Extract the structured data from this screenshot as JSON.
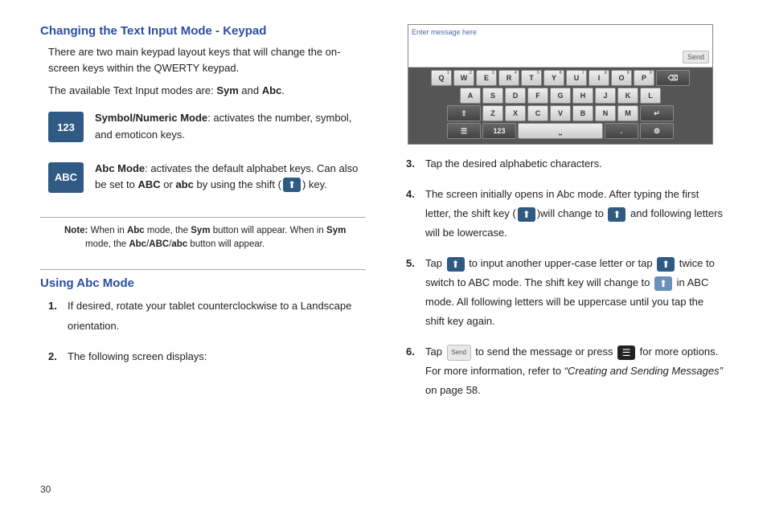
{
  "page_number": "30",
  "left": {
    "h1": "Changing the Text Input Mode - Keypad",
    "p1": "There are two main keypad layout keys that will change the on-screen keys within the QWERTY keypad.",
    "p2_pre": "The available Text Input modes are: ",
    "p2_sym": "Sym",
    "p2_mid": " and ",
    "p2_abc": "Abc",
    "p2_end": ".",
    "tile123": "123",
    "mode123_b": "Symbol/Numeric Mode",
    "mode123_t": ": activates the number, symbol, and emoticon keys.",
    "tileABC": "ABC",
    "modeABC_b": "Abc Mode",
    "modeABC_t1": ": activates the default alphabet keys. Can also be set to ",
    "modeABC_b2": "ABC",
    "modeABC_mid": " or ",
    "modeABC_b3": "abc",
    "modeABC_t2": " by using the shift (",
    "modeABC_t3": ") key.",
    "note_lbl": "Note:",
    "note_1": " When in ",
    "note_b1": "Abc",
    "note_2": " mode, the ",
    "note_b2": "Sym",
    "note_3": " button will appear. When in ",
    "note_b3": "Sym",
    "note_4": " mode, the ",
    "note_b4": "Abc",
    "note_slash1": "/",
    "note_b5": "ABC",
    "note_slash2": "/",
    "note_b6": "abc",
    "note_5": " button will appear.",
    "h2": "Using Abc Mode",
    "li1": "If desired, rotate your tablet counterclockwise to a Landscape orientation.",
    "li2": "The following screen displays:"
  },
  "kbd": {
    "placeholder": "Enter message here",
    "send": "Send",
    "r1": [
      "Q",
      "W",
      "E",
      "R",
      "T",
      "Y",
      "U",
      "I",
      "O",
      "P"
    ],
    "r1s": [
      "1",
      "2",
      "3",
      "4",
      "5",
      "6",
      "7",
      "8",
      "9",
      "0"
    ],
    "r2": [
      "A",
      "S",
      "D",
      "F",
      "G",
      "H",
      "J",
      "K",
      "L"
    ],
    "r3": [
      "Z",
      "X",
      "C",
      "V",
      "B",
      "N",
      "M"
    ],
    "k123": "123",
    "bksp": "⌫",
    "enter": "↵",
    "shift": "⇧"
  },
  "right": {
    "li3": "Tap the desired alphabetic characters.",
    "li4_a": "The screen initially opens in Abc mode. After typing the first letter, the shift key (",
    "li4_b": ")will change to ",
    "li4_c": " and following letters will be lowercase.",
    "li5_a": "Tap ",
    "li5_b": " to input another upper-case letter or tap ",
    "li5_c": " twice to switch to ABC mode. The shift key will change to ",
    "li5_d": " in ABC mode. All following letters will be uppercase until you tap the shift key again.",
    "li6_a": "Tap ",
    "li6_b": " to send the message or press ",
    "li6_c": " for more options. For more information, refer to ",
    "li6_ref": "“Creating and Sending Messages”",
    "li6_d": "  on page 58."
  }
}
